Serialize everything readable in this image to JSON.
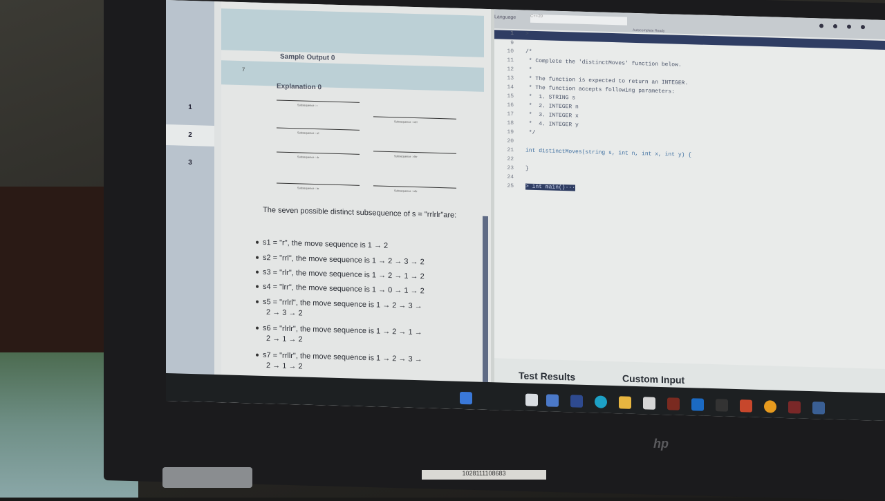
{
  "left_panel": {
    "tabs": [
      "1",
      "2",
      "3"
    ],
    "sample_output_label": "Sample Output 0",
    "sample_output_value": "7",
    "explanation_label": "Explanation 0",
    "figure_captions": [
      "Subsequence : r",
      "Subsequence : rrlrl",
      "Subsequence : rrl",
      "Subsequence : rlrlr",
      "Subsequence : rlr",
      "Subsequence : rrllr",
      "Subsequence : lrr"
    ],
    "explanation_text": "The seven possible distinct subsequence of s = \"rrlrlr\"are:",
    "items": [
      {
        "label": "s1 = \"r\", the move sequence is 1 → 2"
      },
      {
        "label": "s2 = \"rrl\", the move sequence is 1 → 2 → 3 → 2"
      },
      {
        "label": "s3 = \"rlr\", the move sequence is 1 → 2 → 1 → 2"
      },
      {
        "label": "s4 = \"lrr\", the move sequence is 1 → 0 → 1 → 2"
      },
      {
        "label": "s5 = \"rrlrl\", the move sequence is 1 → 2 → 3 →"
      },
      {
        "label": "2 → 3 → 2"
      },
      {
        "label": "s6 = \"rlrlr\", the move sequence is 1 → 2 → 1 →"
      },
      {
        "label": "2 → 1 → 2"
      },
      {
        "label": "s7 = \"rrllr\", the move sequence is 1 → 2 → 3 →"
      },
      {
        "label": "2 → 1 → 2"
      }
    ]
  },
  "editor": {
    "language_label": "Language",
    "language_value": "C++20",
    "autosave_label": "Autocomplete Ready",
    "lines": [
      {
        "n": "1",
        "code": ">"
      },
      {
        "n": "9",
        "code": ""
      },
      {
        "n": "10",
        "code": "/*"
      },
      {
        "n": "11",
        "code": " * Complete the 'distinctMoves' function below."
      },
      {
        "n": "12",
        "code": " *"
      },
      {
        "n": "13",
        "code": " * The function is expected to return an INTEGER."
      },
      {
        "n": "14",
        "code": " * The function accepts following parameters:"
      },
      {
        "n": "15",
        "code": " *  1. STRING s"
      },
      {
        "n": "16",
        "code": " *  2. INTEGER n"
      },
      {
        "n": "17",
        "code": " *  3. INTEGER x"
      },
      {
        "n": "18",
        "code": " *  4. INTEGER y"
      },
      {
        "n": "19",
        "code": " */"
      },
      {
        "n": "20",
        "code": ""
      },
      {
        "n": "21",
        "code": "int distinctMoves(string s, int n, int x, int y) {"
      },
      {
        "n": "22",
        "code": ""
      },
      {
        "n": "23",
        "code": "}"
      },
      {
        "n": "24",
        "code": ""
      },
      {
        "n": "25",
        "code": "> int main()···"
      }
    ],
    "test_results_label": "Test Results",
    "custom_input_label": "Custom Input"
  },
  "laptop": {
    "brand": "hp",
    "sticker": "1028111108683"
  }
}
